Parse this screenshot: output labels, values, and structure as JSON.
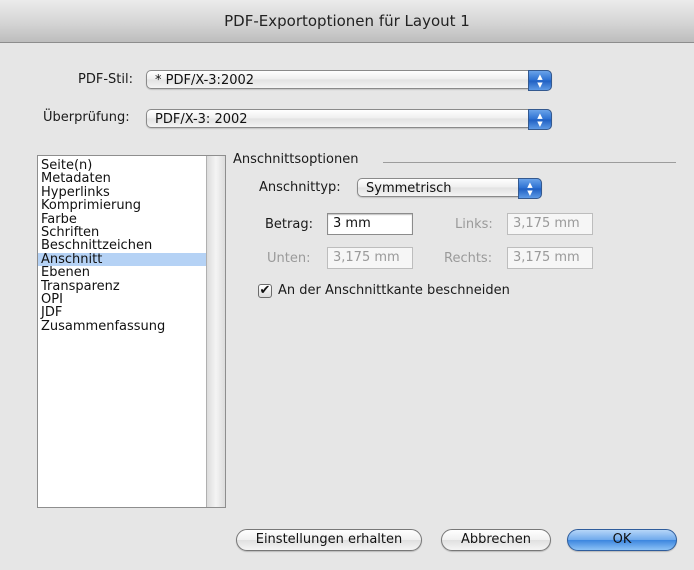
{
  "window": {
    "title": "PDF-Exportoptionen für Layout 1"
  },
  "pdf_stil": {
    "label": "PDF-Stil:",
    "value": "* PDF/X-3:2002"
  },
  "ueberpruefung": {
    "label": "Überprüfung:",
    "value": "PDF/X-3: 2002"
  },
  "sidebar": {
    "items": [
      {
        "label": "Seite(n)"
      },
      {
        "label": "Metadaten"
      },
      {
        "label": "Hyperlinks"
      },
      {
        "label": "Komprimierung"
      },
      {
        "label": "Farbe"
      },
      {
        "label": "Schriften"
      },
      {
        "label": "Beschnittzeichen"
      },
      {
        "label": "Anschnitt"
      },
      {
        "label": "Ebenen"
      },
      {
        "label": "Transparenz"
      },
      {
        "label": "OPI"
      },
      {
        "label": "JDF"
      },
      {
        "label": "Zusammenfassung"
      }
    ],
    "selected": "Anschnitt"
  },
  "group": {
    "title": "Anschnittsoptionen"
  },
  "anschnitttyp": {
    "label": "Anschnittyp:",
    "value": "Symmetrisch"
  },
  "betrag": {
    "label": "Betrag:",
    "value": "3 mm"
  },
  "links": {
    "label": "Links:",
    "value": "3,175 mm"
  },
  "unten": {
    "label": "Unten:",
    "value": "3,175 mm"
  },
  "rechts": {
    "label": "Rechts:",
    "value": "3,175 mm"
  },
  "beschneiden": {
    "label": "An der Anschnittkante beschneiden",
    "checked": true,
    "mark": "✔"
  },
  "buttons": {
    "einstellungen": "Einstellungen erhalten",
    "abbrechen": "Abbrechen",
    "ok": "OK"
  },
  "arrows": {
    "up": "▲",
    "down": "▼"
  }
}
